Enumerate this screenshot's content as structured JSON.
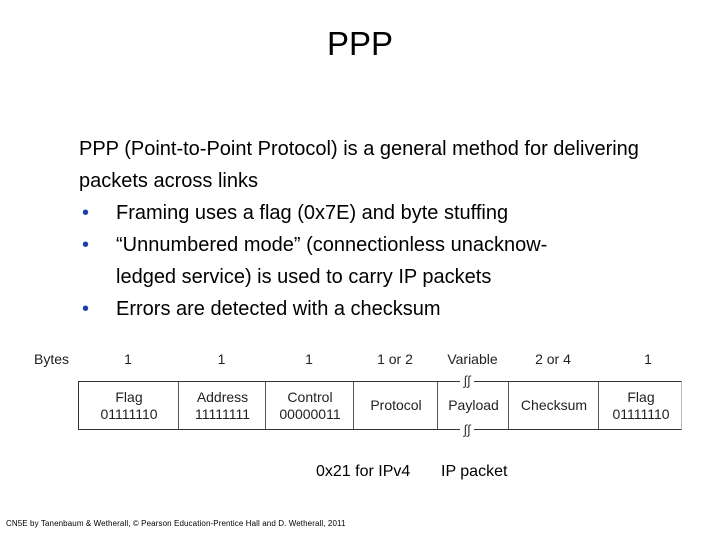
{
  "slide": {
    "title": "PPP",
    "intro": "PPP (Point-to-Point Protocol) is a general method for delivering packets across links",
    "bullets": [
      {
        "symbol": "•",
        "lines": [
          "Framing uses a flag (0x7E) and byte stuffing"
        ]
      },
      {
        "symbol": "•",
        "lines": [
          "“Unnumbered mode” (connectionless unacknow-",
          "ledged service) is used to carry IP packets"
        ]
      },
      {
        "symbol": "•",
        "lines": [
          "Errors are detected with a checksum"
        ]
      }
    ],
    "bullet_color": "#1f3fa8"
  },
  "frame": {
    "bytes_label": "Bytes",
    "fields": [
      {
        "size": "1",
        "name": "Flag",
        "value": "01111110"
      },
      {
        "size": "1",
        "name": "Address",
        "value": "11111111"
      },
      {
        "size": "1",
        "name": "Control",
        "value": "00000011"
      },
      {
        "size": "1 or 2",
        "name": "Protocol",
        "value": ""
      },
      {
        "size": "Variable",
        "name": "Payload",
        "value": ""
      },
      {
        "size": "2 or 4",
        "name": "Checksum",
        "value": ""
      },
      {
        "size": "1",
        "name": "Flag",
        "value": "01111110"
      }
    ],
    "break_symbol": "∫∫",
    "notes": {
      "protocol": "0x21 for IPv4",
      "payload": "IP packet"
    }
  },
  "footer": "CN5E by Tanenbaum & Wetherall, © Pearson Education-Prentice Hall and D. Wetherall, 2011"
}
